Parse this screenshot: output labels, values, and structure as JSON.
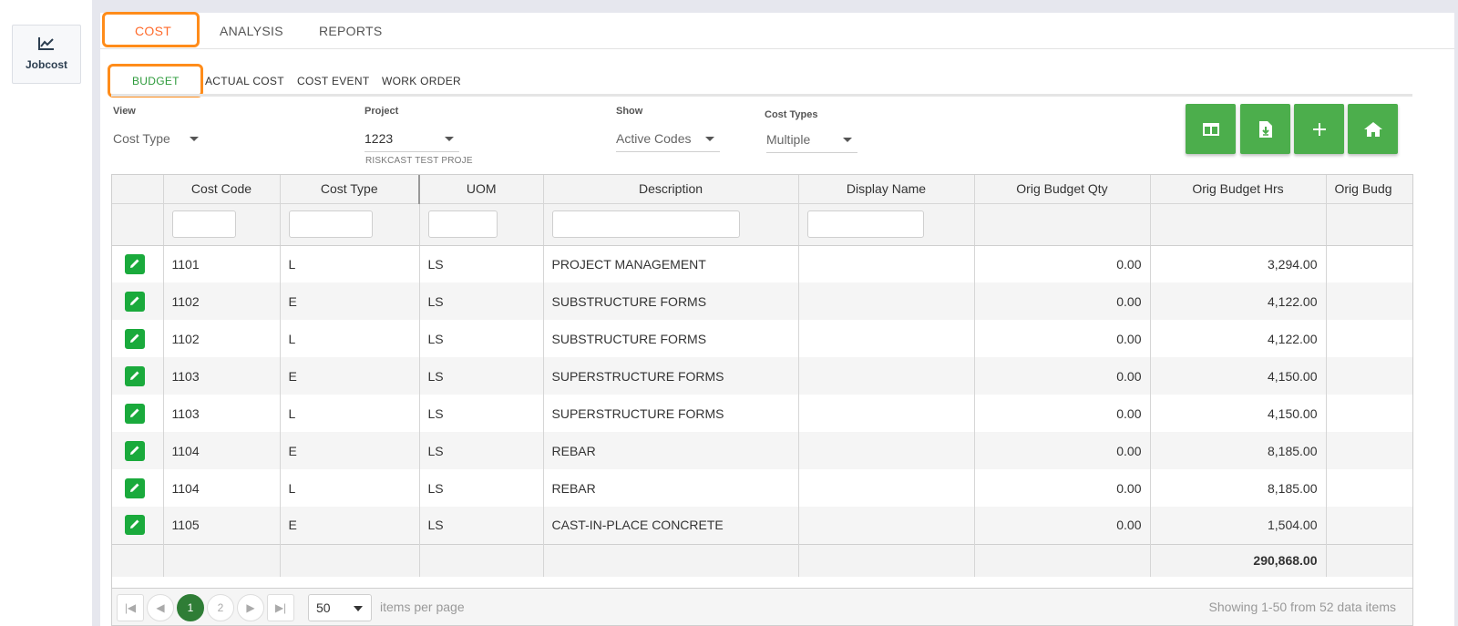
{
  "app": {
    "name": "Jobcost"
  },
  "tabs": [
    {
      "label": "COST",
      "active": true
    },
    {
      "label": "ANALYSIS"
    },
    {
      "label": "REPORTS"
    }
  ],
  "subtabs": [
    {
      "label": "BUDGET",
      "active": true
    },
    {
      "label": "ACTUAL COST"
    },
    {
      "label": "COST EVENT"
    },
    {
      "label": "WORK ORDER"
    }
  ],
  "filters": {
    "view": {
      "label": "View",
      "value": "Cost Type"
    },
    "project": {
      "label": "Project",
      "value": "1223",
      "subtext": "RISKCAST TEST PROJE"
    },
    "show": {
      "label": "Show",
      "value": "Active Codes"
    },
    "cost_types": {
      "label": "Cost Types",
      "value": "Multiple"
    }
  },
  "toolbar": [
    {
      "icon": "columns-icon"
    },
    {
      "icon": "export-file-icon"
    },
    {
      "icon": "add-icon"
    },
    {
      "icon": "home-icon"
    }
  ],
  "grid": {
    "columns": [
      "Cost Code",
      "Cost Type",
      "UOM",
      "Description",
      "Display Name",
      "Orig Budget Qty",
      "Orig Budget Hrs",
      "Orig Budg"
    ],
    "rows": [
      {
        "code": "1101",
        "type": "L",
        "uom": "LS",
        "desc": "PROJECT MANAGEMENT",
        "display": "",
        "qty": "0.00",
        "hrs": "3,294.00"
      },
      {
        "code": "1102",
        "type": "E",
        "uom": "LS",
        "desc": "SUBSTRUCTURE FORMS",
        "display": "",
        "qty": "0.00",
        "hrs": "4,122.00"
      },
      {
        "code": "1102",
        "type": "L",
        "uom": "LS",
        "desc": "SUBSTRUCTURE FORMS",
        "display": "",
        "qty": "0.00",
        "hrs": "4,122.00"
      },
      {
        "code": "1103",
        "type": "E",
        "uom": "LS",
        "desc": "SUPERSTRUCTURE FORMS",
        "display": "",
        "qty": "0.00",
        "hrs": "4,150.00"
      },
      {
        "code": "1103",
        "type": "L",
        "uom": "LS",
        "desc": "SUPERSTRUCTURE FORMS",
        "display": "",
        "qty": "0.00",
        "hrs": "4,150.00"
      },
      {
        "code": "1104",
        "type": "E",
        "uom": "LS",
        "desc": "REBAR",
        "display": "",
        "qty": "0.00",
        "hrs": "8,185.00"
      },
      {
        "code": "1104",
        "type": "L",
        "uom": "LS",
        "desc": "REBAR",
        "display": "",
        "qty": "0.00",
        "hrs": "8,185.00"
      },
      {
        "code": "1105",
        "type": "E",
        "uom": "LS",
        "desc": "CAST-IN-PLACE CONCRETE",
        "display": "",
        "qty": "0.00",
        "hrs": "1,504.00"
      }
    ],
    "total_hrs": "290,868.00"
  },
  "pager": {
    "pages": [
      "1",
      "2"
    ],
    "current": "1",
    "page_size": "50",
    "page_size_label": "items per page",
    "summary": "Showing 1-50 from 52 data items"
  },
  "colors": {
    "accent": "#ff6a2b",
    "highlight": "#ff8c1a",
    "green": "#4cae4c",
    "edit": "#1aaa3c"
  }
}
